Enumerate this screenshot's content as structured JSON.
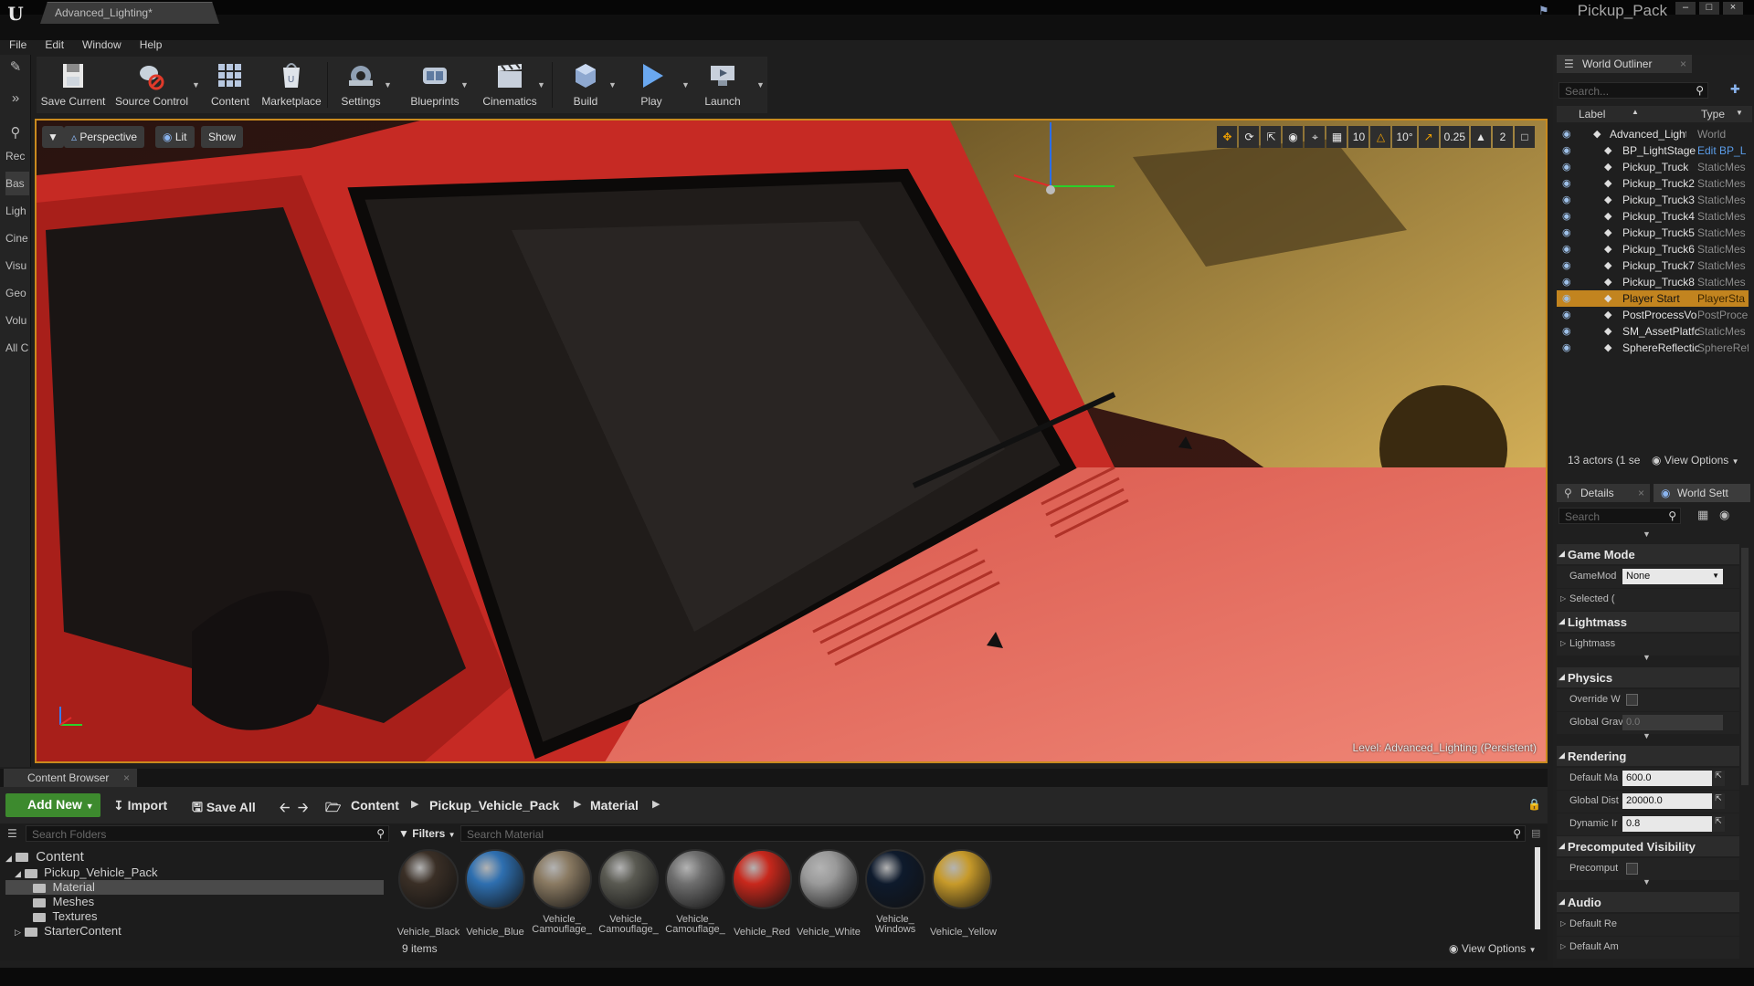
{
  "window": {
    "doc_tab": "Advanced_Lighting*",
    "project_name": "Pickup_Pack"
  },
  "menu": [
    "File",
    "Edit",
    "Window",
    "Help"
  ],
  "mode_tabs": [
    "Rec",
    "Bas",
    "Ligh",
    "Cine",
    "Visu",
    "Geo",
    "Volu",
    "All C"
  ],
  "toolbar": {
    "buttons": [
      {
        "label": "Save Current",
        "icon": "save-icon"
      },
      {
        "label": "Source Control",
        "icon": "source-control-icon"
      },
      {
        "label": "Content",
        "icon": "content-icon"
      },
      {
        "label": "Marketplace",
        "icon": "marketplace-icon"
      },
      {
        "label": "Settings",
        "icon": "settings-icon"
      },
      {
        "label": "Blueprints",
        "icon": "blueprints-icon"
      },
      {
        "label": "Cinematics",
        "icon": "cinematics-icon"
      },
      {
        "label": "Build",
        "icon": "build-icon"
      },
      {
        "label": "Play",
        "icon": "play-icon"
      },
      {
        "label": "Launch",
        "icon": "launch-icon"
      }
    ]
  },
  "viewport": {
    "perspective": "Perspective",
    "lit": "Lit",
    "show": "Show",
    "grid_snap": "10",
    "rot_snap": "10°",
    "scale_snap": "0.25",
    "camera_speed": "2",
    "level_label": "Level:",
    "level_name": "Advanced_Lighting (Persistent)"
  },
  "content_browser": {
    "tab": "Content Browser",
    "add_new": "Add New",
    "import": "Import",
    "save_all": "Save All",
    "breadcrumb": [
      "Content",
      "Pickup_Vehicle_Pack",
      "Material"
    ],
    "folder_search_placeholder": "Search Folders",
    "asset_search_placeholder": "Search Material",
    "filters": "Filters",
    "tree": [
      {
        "label": "Content",
        "level": 0
      },
      {
        "label": "Pickup_Vehicle_Pack",
        "level": 1
      },
      {
        "label": "Material",
        "level": 2,
        "selected": true
      },
      {
        "label": "Meshes",
        "level": 2
      },
      {
        "label": "Textures",
        "level": 2
      },
      {
        "label": "StarterContent",
        "level": 1
      }
    ],
    "assets": [
      {
        "name1": "Vehicle_Black",
        "name2": "",
        "color": "#3a2f26"
      },
      {
        "name1": "Vehicle_Blue",
        "name2": "",
        "color": "#2e6fb0"
      },
      {
        "name1": "Vehicle_",
        "name2": "Camouflage_",
        "color": "#8a7a62"
      },
      {
        "name1": "Vehicle_",
        "name2": "Camouflage_",
        "color": "#5a5a52"
      },
      {
        "name1": "Vehicle_",
        "name2": "Camouflage_",
        "color": "#6e6e6e"
      },
      {
        "name1": "Vehicle_Red",
        "name2": "",
        "color": "#c8281c"
      },
      {
        "name1": "Vehicle_White",
        "name2": "",
        "color": "#9a9a9a"
      },
      {
        "name1": "Vehicle_",
        "name2": "Windows",
        "color": "#0e1a2c"
      },
      {
        "name1": "Vehicle_Yellow",
        "name2": "",
        "color": "#c79a2a"
      }
    ],
    "items_count": "9 items",
    "view_options": "View Options"
  },
  "world_outliner": {
    "tab": "World Outliner",
    "search_placeholder": "Search...",
    "col_label": "Label",
    "col_type": "Type",
    "rows": [
      {
        "label": "Advanced_Lightir",
        "type": "World",
        "indent": 0
      },
      {
        "label": "BP_LightStage",
        "type": "Edit BP_L",
        "indent": 1,
        "link": true
      },
      {
        "label": "Pickup_Truck",
        "type": "StaticMes",
        "indent": 1
      },
      {
        "label": "Pickup_Truck2",
        "type": "StaticMes",
        "indent": 1
      },
      {
        "label": "Pickup_Truck3",
        "type": "StaticMes",
        "indent": 1
      },
      {
        "label": "Pickup_Truck4",
        "type": "StaticMes",
        "indent": 1
      },
      {
        "label": "Pickup_Truck5",
        "type": "StaticMes",
        "indent": 1
      },
      {
        "label": "Pickup_Truck6",
        "type": "StaticMes",
        "indent": 1
      },
      {
        "label": "Pickup_Truck7",
        "type": "StaticMes",
        "indent": 1
      },
      {
        "label": "Pickup_Truck8",
        "type": "StaticMes",
        "indent": 1
      },
      {
        "label": "Player Start",
        "type": "PlayerSta",
        "indent": 1,
        "selected": true
      },
      {
        "label": "PostProcessVo",
        "type": "PostProce",
        "indent": 1
      },
      {
        "label": "SM_AssetPlatfc",
        "type": "StaticMes",
        "indent": 1
      },
      {
        "label": "SphereReflectic",
        "type": "SphereRef",
        "indent": 1
      }
    ],
    "footer": "13 actors (1 se",
    "view_options": "View Options"
  },
  "details": {
    "tab_details": "Details",
    "tab_world": "World Sett",
    "search_placeholder": "Search",
    "sections": [
      {
        "title": "Game Mode",
        "props": [
          {
            "label": "GameMod",
            "kind": "select",
            "value": "None"
          },
          {
            "label": "Selected (",
            "kind": "expand",
            "value": ""
          }
        ]
      },
      {
        "title": "Lightmass",
        "props": [
          {
            "label": "Lightmass",
            "kind": "expand",
            "value": ""
          }
        ]
      },
      {
        "title": "Physics",
        "props": [
          {
            "label": "Override W",
            "kind": "check",
            "value": ""
          },
          {
            "label": "Global Grav",
            "kind": "disabled",
            "value": "0.0"
          }
        ]
      },
      {
        "title": "Rendering",
        "props": [
          {
            "label": "Default Ma",
            "kind": "number",
            "value": "600.0"
          },
          {
            "label": "Global Dist",
            "kind": "number",
            "value": "20000.0"
          },
          {
            "label": "Dynamic Ir",
            "kind": "number",
            "value": "0.8"
          }
        ]
      },
      {
        "title": "Precomputed Visibility",
        "props": [
          {
            "label": "Precomput",
            "kind": "check",
            "value": ""
          }
        ]
      },
      {
        "title": "Audio",
        "props": [
          {
            "label": "Default Re",
            "kind": "expand",
            "value": ""
          },
          {
            "label": "Default Am",
            "kind": "expand",
            "value": ""
          }
        ]
      }
    ]
  }
}
